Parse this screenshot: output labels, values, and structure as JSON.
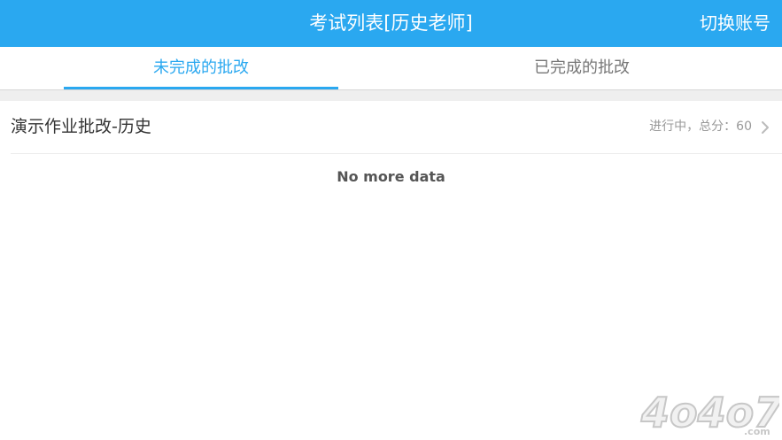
{
  "header": {
    "title": "考试列表[历史老师]",
    "switch_account_label": "切换账号",
    "background_color": "#2aa8f0"
  },
  "tabs": [
    {
      "label": "未完成的批改",
      "active": true
    },
    {
      "label": "已完成的批改",
      "active": false
    }
  ],
  "accent_color": "#2aa8f0",
  "list": {
    "items": [
      {
        "title": "演示作业批改-历史",
        "meta": "进行中，总分：60",
        "icon": "chevron-right-icon"
      }
    ],
    "footer": "No more data"
  },
  "watermark": {
    "text": "4o4o7.com",
    "icon": "site-watermark-logo"
  }
}
